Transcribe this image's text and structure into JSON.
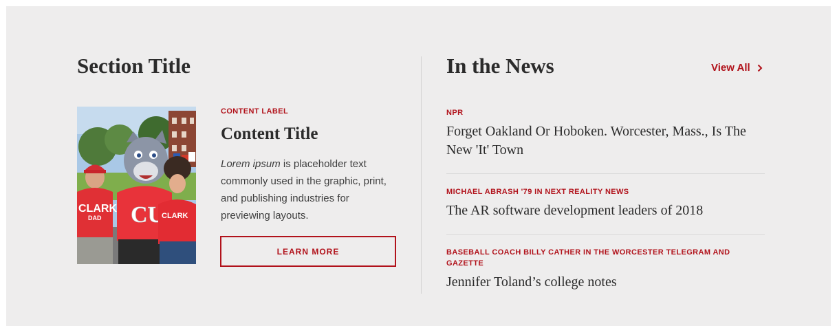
{
  "left": {
    "section_title": "Section Title",
    "content_label": "CONTENT LABEL",
    "content_title": "Content Title",
    "body_italic": "Lorem ipsum",
    "body_rest": " is placeholder text commonly used in the graphic, print, and publishing industries for previewing layouts.",
    "button_label": "LEARN MORE",
    "photo": {
      "shirt_text_left": "CLARK",
      "shirt_text_left_sub": "DAD",
      "shirt_text_mascot": "CU",
      "shirt_text_right": "CLARK"
    }
  },
  "right": {
    "title": "In the News",
    "view_all_label": "View All",
    "items": [
      {
        "source": "NPR",
        "headline": "Forget Oakland Or Hoboken. Worcester, Mass., Is The New 'It' Town"
      },
      {
        "source": "MICHAEL ABRASH '79 IN NEXT REALITY NEWS",
        "headline": "The AR software development leaders of 2018"
      },
      {
        "source": "BASEBALL COACH BILLY CATHER IN THE WORCESTER TELEGRAM AND GAZETTE",
        "headline": "Jennifer Toland’s college notes"
      }
    ]
  },
  "colors": {
    "accent": "#b1121b",
    "panel_bg": "#eeeded",
    "text": "#2b2b2b"
  },
  "icons": {
    "view_all": "chevron-right-icon"
  }
}
